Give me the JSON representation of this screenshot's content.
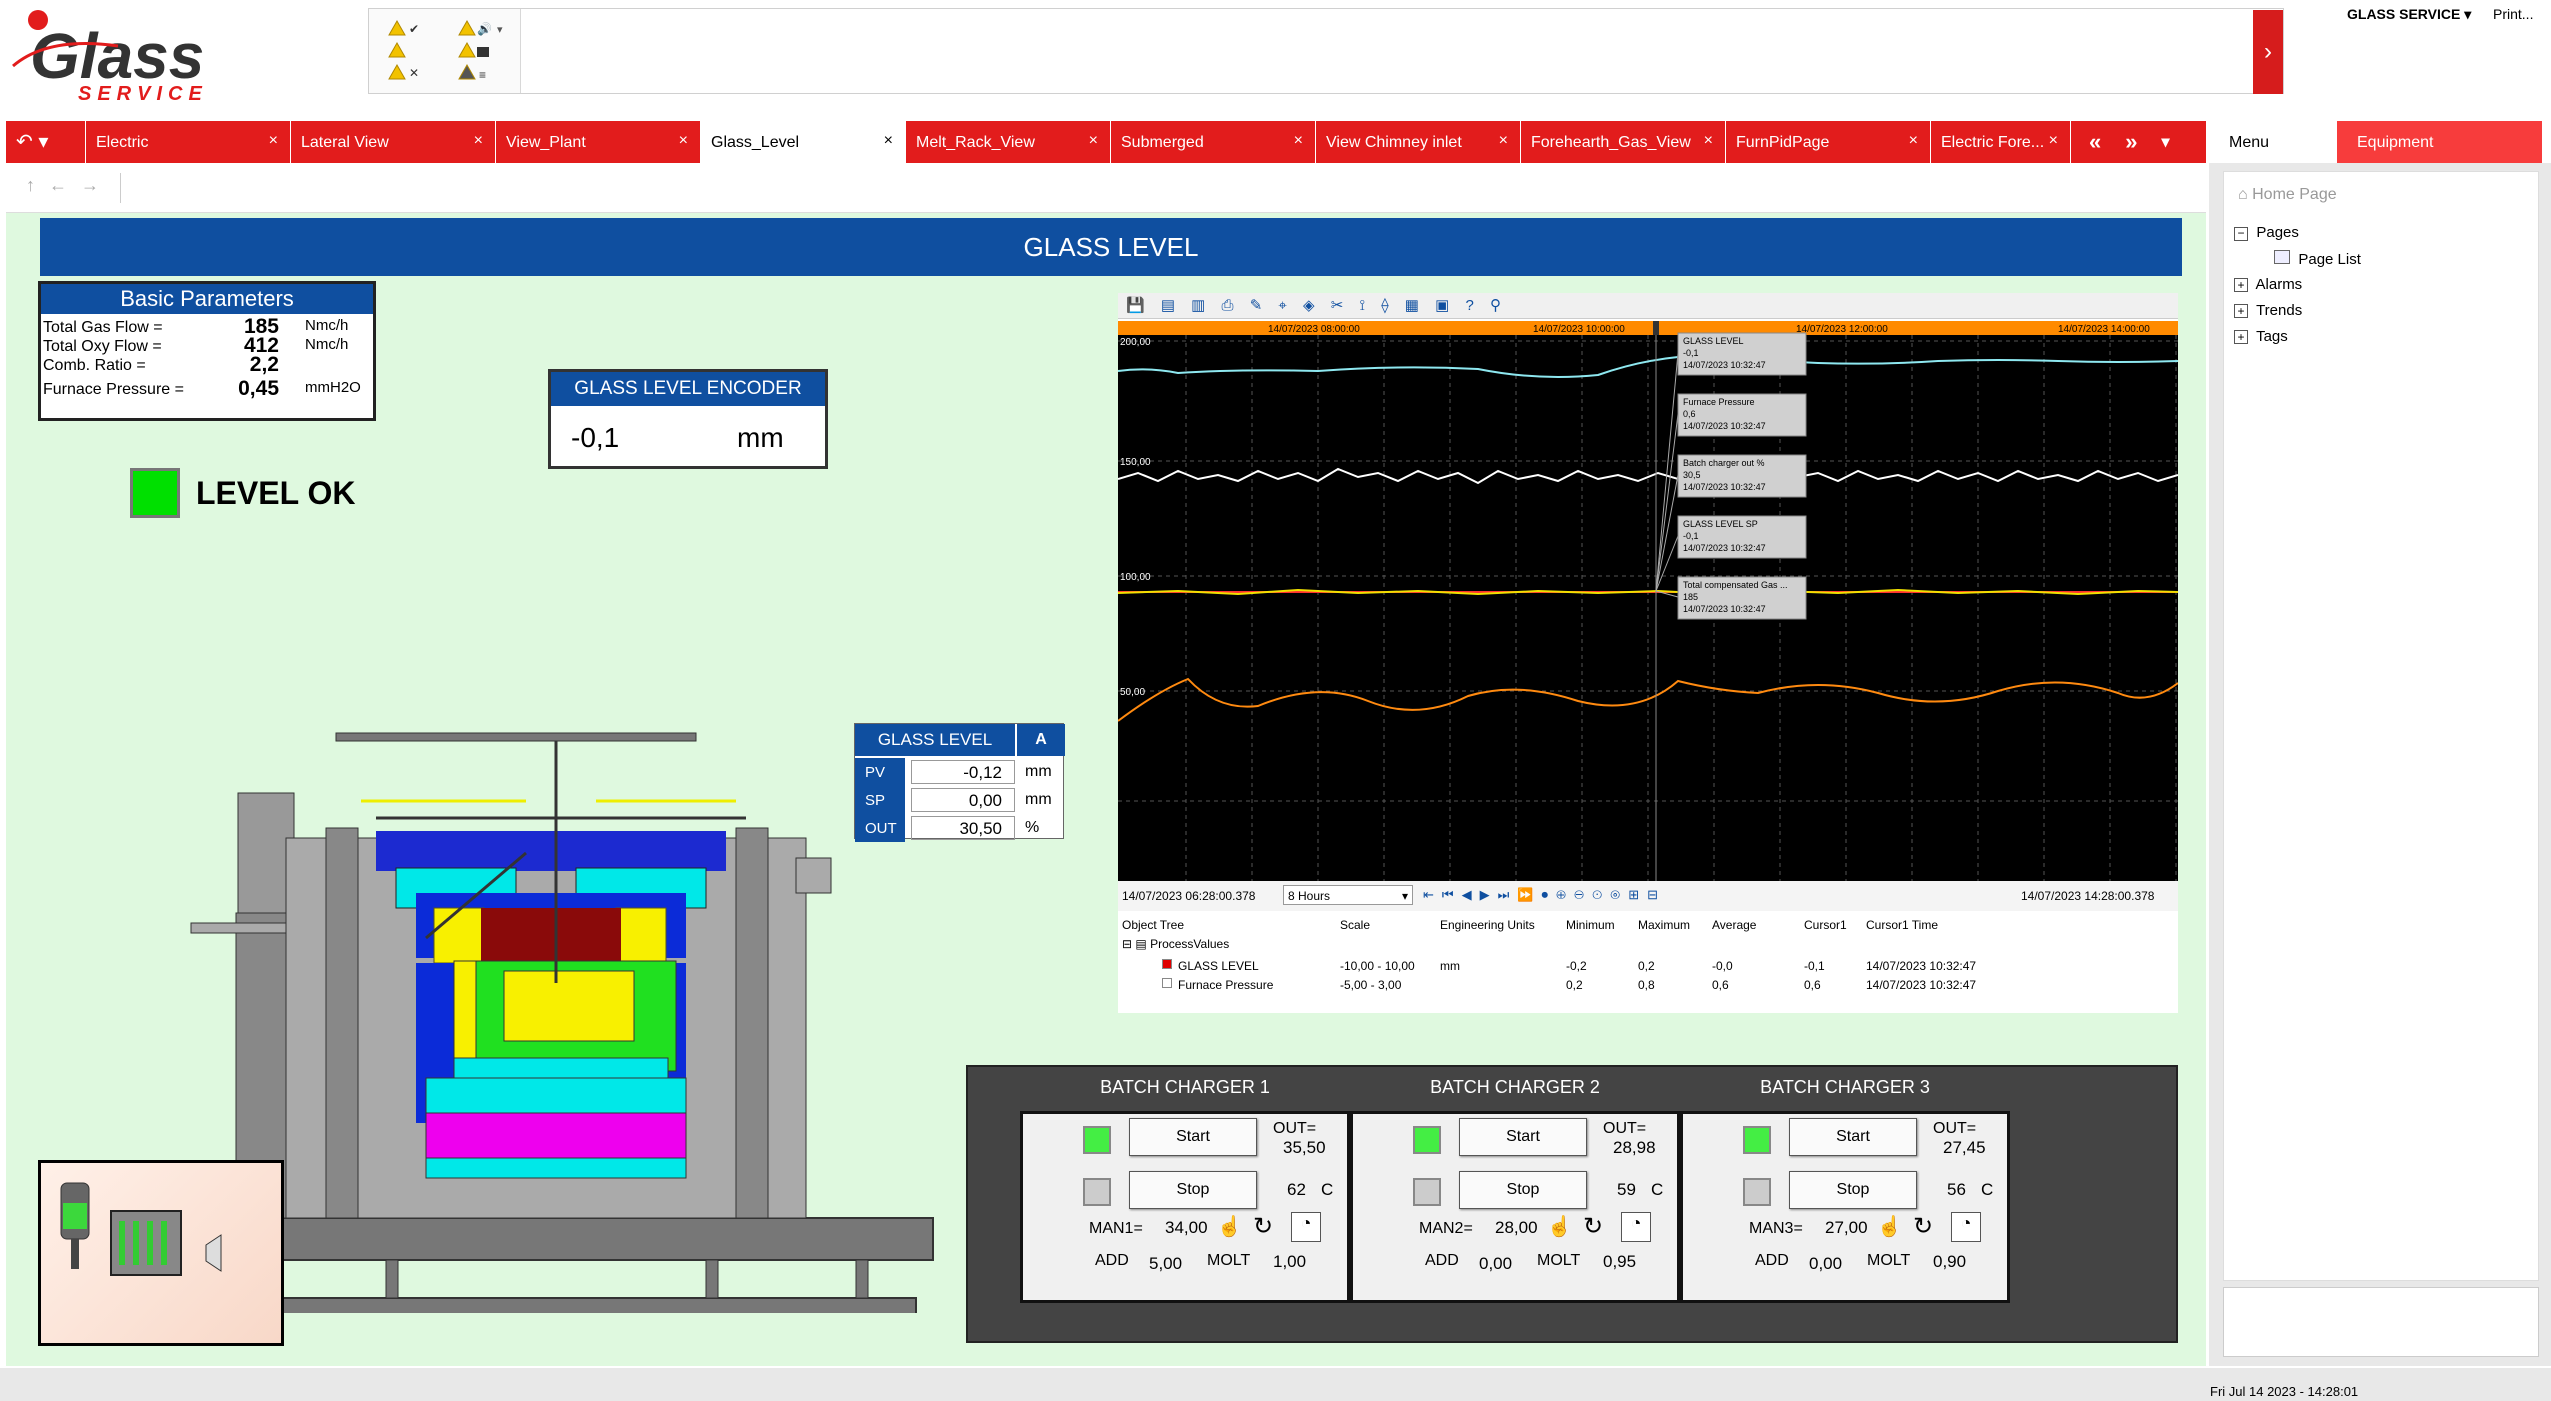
{
  "header": {
    "logo_text": "Glass",
    "logo_sub": "SERVICE",
    "user": "GLASS SERVICE",
    "print": "Print..."
  },
  "tabs": [
    {
      "label": "Electric"
    },
    {
      "label": "Lateral View"
    },
    {
      "label": "View_Plant"
    },
    {
      "label": "Glass_Level",
      "active": true
    },
    {
      "label": "Melt_Rack_View"
    },
    {
      "label": "Submerged"
    },
    {
      "label": "View Chimney inlet"
    },
    {
      "label": "Forehearth_Gas_View"
    },
    {
      "label": "FurnPidPage"
    },
    {
      "label": "Electric Fore..."
    }
  ],
  "right_tabs": {
    "menu": "Menu",
    "equipment": "Equipment"
  },
  "tree": {
    "home": "Home Page",
    "pages": "Pages",
    "page_list": "Page List",
    "alarms": "Alarms",
    "trends": "Trends",
    "tags": "Tags"
  },
  "page_title": "GLASS LEVEL",
  "basic_params": {
    "title": "Basic Parameters",
    "rows": [
      {
        "label": "Total Gas Flow =",
        "value": "185",
        "unit": "Nmc/h"
      },
      {
        "label": "Total Oxy Flow =",
        "value": "412",
        "unit": "Nmc/h"
      },
      {
        "label": "Comb. Ratio =",
        "value": "2,2",
        "unit": ""
      },
      {
        "label": "Furnace Pressure =",
        "value": "0,45",
        "unit": "mmH2O"
      }
    ]
  },
  "encoder": {
    "title": "GLASS LEVEL ENCODER",
    "value": "-0,1",
    "unit": "mm"
  },
  "level_status": {
    "text": "LEVEL OK",
    "color": "#00e000"
  },
  "glass_level_pid": {
    "title": "GLASS LEVEL",
    "mode": "A",
    "rows": [
      {
        "label": "PV",
        "value": "-0,12",
        "unit": "mm"
      },
      {
        "label": "SP",
        "value": "0,00",
        "unit": "mm"
      },
      {
        "label": "OUT",
        "value": "30,50",
        "unit": "%"
      }
    ]
  },
  "trend": {
    "time_labels": [
      "14/07/2023 08:00:00",
      "14/07/2023 10:00:00",
      "14/07/2023 12:00:00",
      "14/07/2023 14:00:00"
    ],
    "y_labels": [
      "200,00",
      "150,00",
      "100,00",
      "50,00"
    ],
    "tooltips": [
      {
        "name": "GLASS LEVEL",
        "value": "-0,1",
        "time": "14/07/2023 10:32:47"
      },
      {
        "name": "Furnace Pressure",
        "value": "0,6",
        "time": "14/07/2023 10:32:47"
      },
      {
        "name": "Batch charger out %",
        "value": "30,5",
        "time": "14/07/2023 10:32:47"
      },
      {
        "name": "GLASS LEVEL SP",
        "value": "-0,1",
        "time": "14/07/2023 10:32:47"
      },
      {
        "name": "Total compensated Gas ...",
        "value": "185",
        "time": "14/07/2023 10:32:47"
      }
    ],
    "start_time": "14/07/2023 06:28:00.378",
    "range": "8 Hours",
    "end_time": "14/07/2023 14:28:00.378",
    "columns": [
      "Object Tree",
      "Scale",
      "Engineering Units",
      "Minimum",
      "Maximum",
      "Average",
      "Cursor1",
      "Cursor1 Time"
    ],
    "group": "ProcessValues",
    "rows": [
      {
        "name": "GLASS LEVEL",
        "scale": "-10,00 - 10,00",
        "eu": "mm",
        "min": "-0,2",
        "max": "0,2",
        "avg": "-0,0",
        "cur": "-0,1",
        "time": "14/07/2023 10:32:47",
        "color": "#e00000"
      },
      {
        "name": "Furnace Pressure",
        "scale": "-5,00 - 3,00",
        "eu": "",
        "min": "0,2",
        "max": "0,8",
        "avg": "0,6",
        "cur": "0,6",
        "time": "14/07/2023 10:32:47",
        "color": "#ffffff"
      }
    ]
  },
  "batch_chargers": [
    {
      "title": "BATCH CHARGER 1",
      "start": "Start",
      "stop": "Stop",
      "out_label": "OUT=",
      "out": "35,50",
      "temp": "62",
      "temp_unit": "C",
      "man_label": "MAN1=",
      "man": "34,00",
      "add_label": "ADD",
      "add": "5,00",
      "molt_label": "MOLT",
      "molt": "1,00"
    },
    {
      "title": "BATCH CHARGER 2",
      "start": "Start",
      "stop": "Stop",
      "out_label": "OUT=",
      "out": "28,98",
      "temp": "59",
      "temp_unit": "C",
      "man_label": "MAN2=",
      "man": "28,00",
      "add_label": "ADD",
      "add": "0,00",
      "molt_label": "MOLT",
      "molt": "0,95"
    },
    {
      "title": "BATCH CHARGER 3",
      "start": "Start",
      "stop": "Stop",
      "out_label": "OUT=",
      "out": "27,45",
      "temp": "56",
      "temp_unit": "C",
      "man_label": "MAN3=",
      "man": "27,00",
      "add_label": "ADD",
      "add": "0,00",
      "molt_label": "MOLT",
      "molt": "0,90"
    }
  ],
  "status": {
    "clock": "Fri Jul 14 2023 - 14:28:01"
  },
  "colors": {
    "brand_red": "#e21c1c",
    "title_blue": "#0f4fa0",
    "panel_green": "#dff9df",
    "lamp_on": "#44ee44"
  }
}
